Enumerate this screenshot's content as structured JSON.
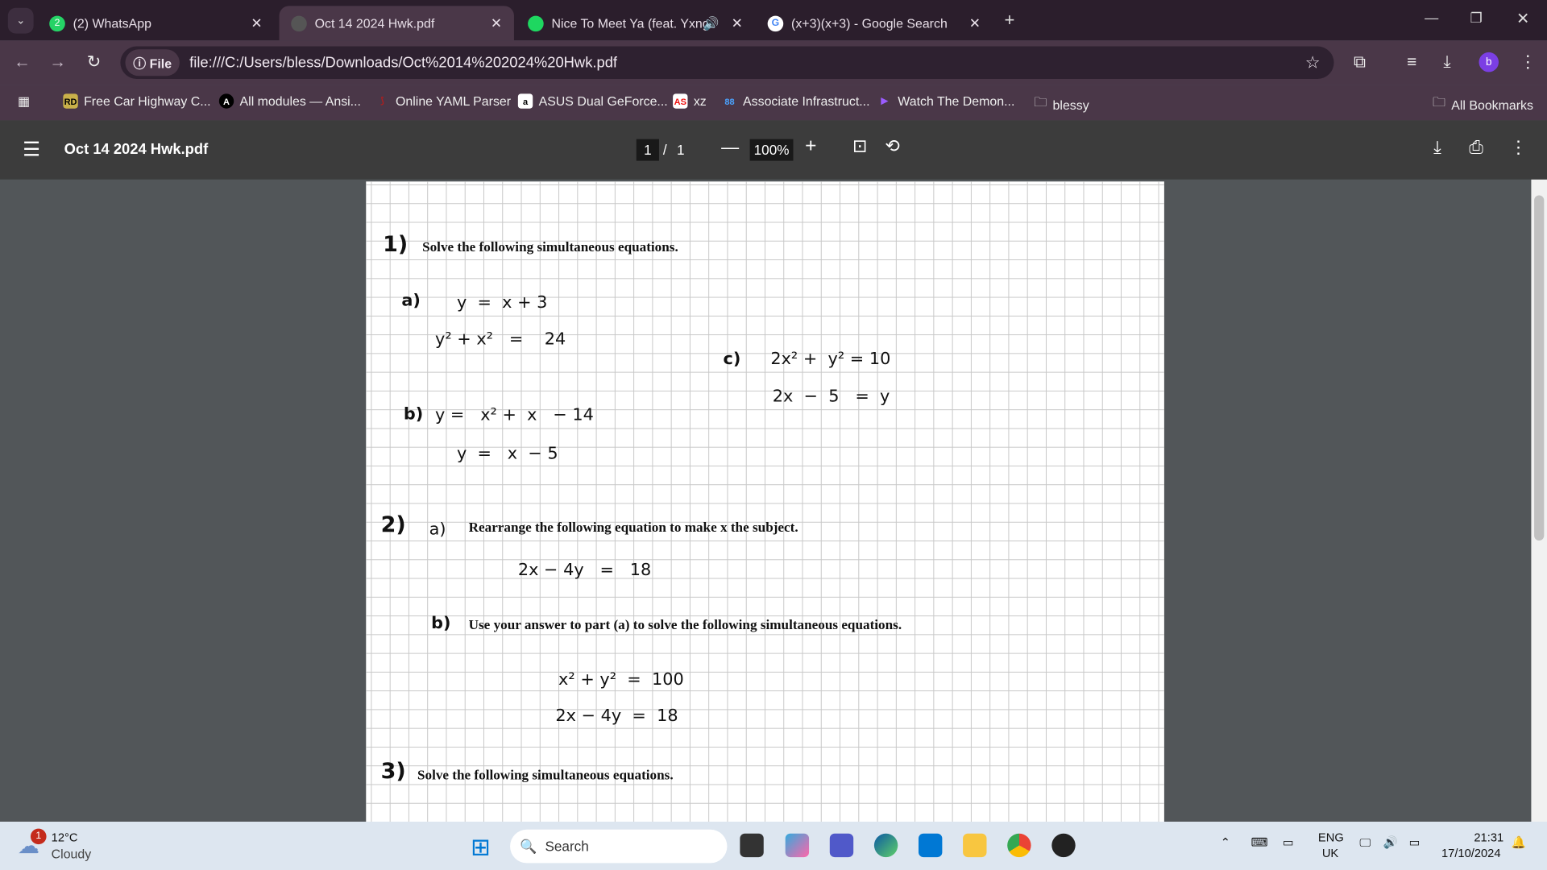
{
  "tabs": [
    {
      "label": "(2) WhatsApp",
      "badge": "2",
      "icon": "whatsapp-icon"
    },
    {
      "label": "Oct 14 2024 Hwk.pdf",
      "icon": "globe-icon",
      "active": true
    },
    {
      "label": "Nice To Meet Ya (feat. Yxng",
      "icon": "spotify-icon",
      "audio": true
    },
    {
      "label": "(x+3)(x+3) - Google Search",
      "icon": "google-icon"
    }
  ],
  "address": {
    "chip": "File",
    "url": "file:///C:/Users/bless/Downloads/Oct%2014%202024%20Hwk.pdf",
    "profile": "b"
  },
  "bookmarks": [
    {
      "label": "Free Car Highway C...",
      "icon": "RD",
      "color": "#c9b04a"
    },
    {
      "label": "All modules — Ansi...",
      "icon": "A",
      "color": "#000"
    },
    {
      "label": "Online YAML Parser",
      "icon": "⟆",
      "color": "#b01e1e"
    },
    {
      "label": "ASUS Dual GeForce...",
      "icon": "a",
      "color": "#fff"
    },
    {
      "label": "xz",
      "icon": "AS",
      "color": "#e11"
    },
    {
      "label": "Associate Infrastruct...",
      "icon": "88",
      "color": "#4aa3ff"
    },
    {
      "label": "Watch The Demon...",
      "icon": "▶",
      "color": "#9b5cff"
    },
    {
      "label": "blessy",
      "icon": "folder"
    }
  ],
  "all_bookmarks": "All Bookmarks",
  "pdf": {
    "title": "Oct 14 2024 Hwk.pdf",
    "page": "1",
    "sep": "/",
    "total": "1",
    "zoom": "100%"
  },
  "doc": {
    "q1_num": "1)",
    "q1": "Solve the following simultaneous equations.",
    "a": "a)",
    "a1": "y  =  x + 3",
    "a2": "y² + x²   =    24",
    "b": "b)",
    "b1": "y =   x² +  x   − 14",
    "b2": "y  =   x  − 5",
    "c": "c)",
    "c1": "2x² +  y² = 10",
    "c2": "2x  −  5   =  y",
    "q2_num": "2)",
    "q2a_lbl": "a)",
    "q2a": "Rearrange the following equation to make x the subject.",
    "q2a_eq": "2x − 4y   =   18",
    "q2b_lbl": "b)",
    "q2b": "Use your answer to part (a) to solve the following simultaneous equations.",
    "q2b_eq1": "x² + y²  =  100",
    "q2b_eq2": "2x − 4y  =  18",
    "q3_num": "3)",
    "q3": "Solve the following simultaneous equations."
  },
  "taskbar": {
    "weather_badge": "1",
    "temp": "12°C",
    "cond": "Cloudy",
    "search": "Search",
    "lang1": "ENG",
    "lang2": "UK",
    "time": "21:31",
    "date": "17/10/2024"
  }
}
